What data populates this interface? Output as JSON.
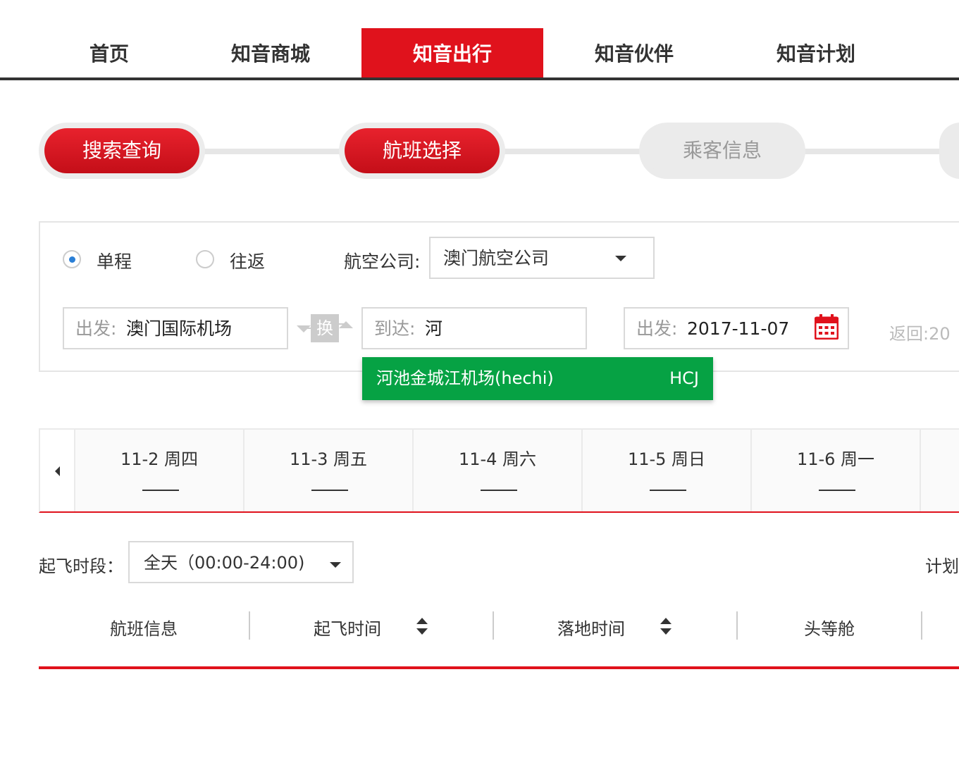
{
  "nav": {
    "items": [
      {
        "label": "首页",
        "active": false
      },
      {
        "label": "知音商城",
        "active": false
      },
      {
        "label": "知音出行",
        "active": true
      },
      {
        "label": "知音伙伴",
        "active": false
      },
      {
        "label": "知音计划",
        "active": false
      }
    ],
    "accent": "#e0121c"
  },
  "steps": [
    {
      "label": "搜索查询",
      "state": "done"
    },
    {
      "label": "航班选择",
      "state": "done"
    },
    {
      "label": "乘客信息",
      "state": "todo"
    }
  ],
  "search": {
    "trip_one_way": "单程",
    "trip_round": "往返",
    "trip_selected": "单程",
    "airline_label": "航空公司:",
    "airline_value": "澳门航空公司",
    "from_prefix": "出发:",
    "from_value": "澳门国际机场",
    "swap_label": "换",
    "to_prefix": "到达:",
    "to_value": "河",
    "depart_prefix": "出发:",
    "depart_value": "2017-11-07",
    "return_partial": "返回:20"
  },
  "suggestion": {
    "name": "河池金城江机场(hechi)",
    "code": "HCJ",
    "color": "#06a244"
  },
  "dates": [
    {
      "label": "11-2 周四"
    },
    {
      "label": "11-3 周五"
    },
    {
      "label": "11-4 周六"
    },
    {
      "label": "11-5 周日"
    },
    {
      "label": "11-6 周一"
    }
  ],
  "filter": {
    "time_label": "起飞时段：",
    "time_value": "全天（00:00-24:00)",
    "plan_partial": "计划"
  },
  "table": {
    "headers": [
      "航班信息",
      "起飞时间",
      "落地时间",
      "头等舱"
    ]
  }
}
